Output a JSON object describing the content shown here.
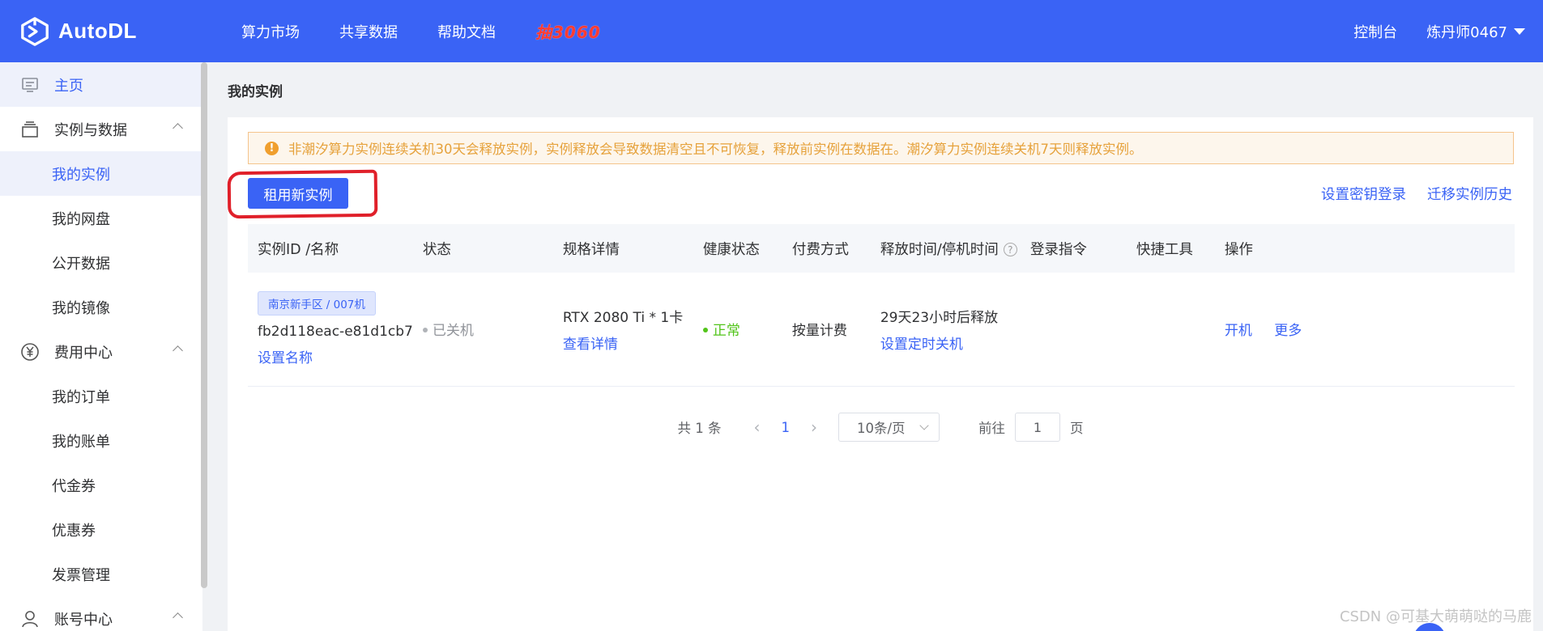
{
  "header": {
    "logo_text": "AutoDL",
    "nav": [
      "算力市场",
      "共享数据",
      "帮助文档"
    ],
    "promo": "抽3060",
    "console": "控制台",
    "user": "炼丹师0467"
  },
  "sidebar": {
    "home": "主页",
    "sections": [
      {
        "label": "实例与数据",
        "icon": "layers-icon",
        "items": [
          "我的实例",
          "我的网盘",
          "公开数据",
          "我的镜像"
        ]
      },
      {
        "label": "费用中心",
        "icon": "yen-icon",
        "items": [
          "我的订单",
          "我的账单",
          "代金券",
          "优惠券",
          "发票管理"
        ]
      },
      {
        "label": "账号中心",
        "icon": "user-icon",
        "items": []
      }
    ],
    "active_item": "我的实例"
  },
  "main": {
    "title": "我的实例",
    "alert": "非潮汐算力实例连续关机30天会释放实例，实例释放会导致数据清空且不可恢复，释放前实例在数据在。潮汐算力实例连续关机7天则释放实例。",
    "new_button": "租用新实例",
    "links": [
      "设置密钥登录",
      "迁移实例历史"
    ],
    "table": {
      "headers": [
        "实例ID /名称",
        "状态",
        "规格详情",
        "健康状态",
        "付费方式",
        "释放时间/停机时间",
        "登录指令",
        "快捷工具",
        "操作"
      ],
      "rows": [
        {
          "region_tag": "南京新手区 / 007机",
          "id": "fb2d118eac-e81d1cb7",
          "rename": "设置名称",
          "status": "已关机",
          "spec": "RTX 2080 Ti * 1卡",
          "spec_link": "查看详情",
          "health": "正常",
          "billing": "按量计费",
          "release": "29天23小时后释放",
          "release_link": "设置定时关机",
          "actions": [
            "开机",
            "更多"
          ]
        }
      ]
    },
    "pagination": {
      "total": "共 1 条",
      "current": "1",
      "page_size": "10条/页",
      "goto_label": "前往",
      "goto_value": "1",
      "page_suffix": "页"
    }
  },
  "watermark": "CSDN @可基大萌萌哒的马鹿",
  "colors": {
    "primary": "#3a63f5",
    "warning": "#e6a23c",
    "success": "#52c41a",
    "highlight_ring": "#e0202a"
  }
}
